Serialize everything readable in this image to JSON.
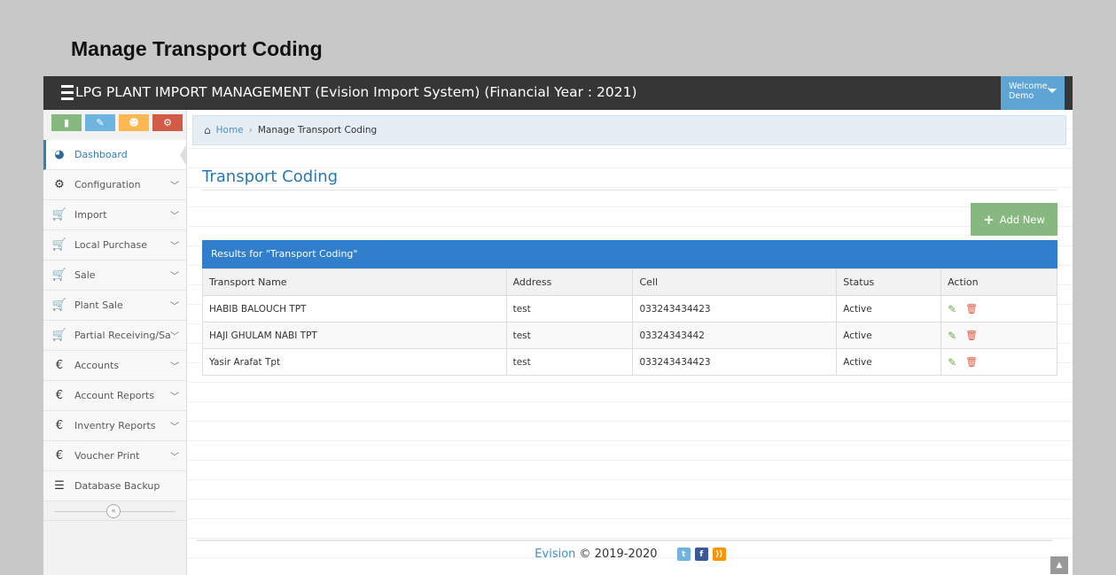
{
  "page_heading": "Manage Transport Coding",
  "app": {
    "title": "LPG PLANT IMPORT MANAGEMENT (Evision Import System) (Financial Year : 2021)",
    "welcome_line1": "Welcome,",
    "welcome_line2": "Demo"
  },
  "sidebar": {
    "items": [
      {
        "label": "Dashboard",
        "icon": "dashboard-icon",
        "active": true
      },
      {
        "label": "Configuration",
        "icon": "cogs-icon"
      },
      {
        "label": "Import",
        "icon": "cart-icon"
      },
      {
        "label": "Local Purchase",
        "icon": "cart-icon"
      },
      {
        "label": "Sale",
        "icon": "cart-icon"
      },
      {
        "label": "Plant Sale",
        "icon": "cart-icon"
      },
      {
        "label": "Partial Receiving/Sale",
        "icon": "cart-icon"
      },
      {
        "label": "Accounts",
        "icon": "euro-icon"
      },
      {
        "label": "Account Reports",
        "icon": "euro-icon"
      },
      {
        "label": "Inventry Reports",
        "icon": "euro-icon"
      },
      {
        "label": "Voucher Print",
        "icon": "euro-icon"
      },
      {
        "label": "Database Backup",
        "icon": "database-icon"
      }
    ]
  },
  "breadcrumb": {
    "home": "Home",
    "current": "Manage Transport Coding"
  },
  "main": {
    "title": "Transport Coding",
    "add_button": "Add New",
    "results_label": "Results for \"Transport Coding\""
  },
  "table": {
    "headers": [
      "Transport Name",
      "Address",
      "Cell",
      "Status",
      "Action"
    ],
    "rows": [
      {
        "name": "HABIB BALOUCH TPT",
        "address": "test",
        "cell": "033243434423",
        "status": "Active"
      },
      {
        "name": "HAJI GHULAM NABI TPT",
        "address": "test",
        "cell": "03324343442",
        "status": "Active"
      },
      {
        "name": "Yasir Arafat Tpt",
        "address": "test",
        "cell": "033243434423",
        "status": "Active"
      }
    ]
  },
  "footer": {
    "brand": "Evision",
    "copyright": "© 2019-2020"
  }
}
